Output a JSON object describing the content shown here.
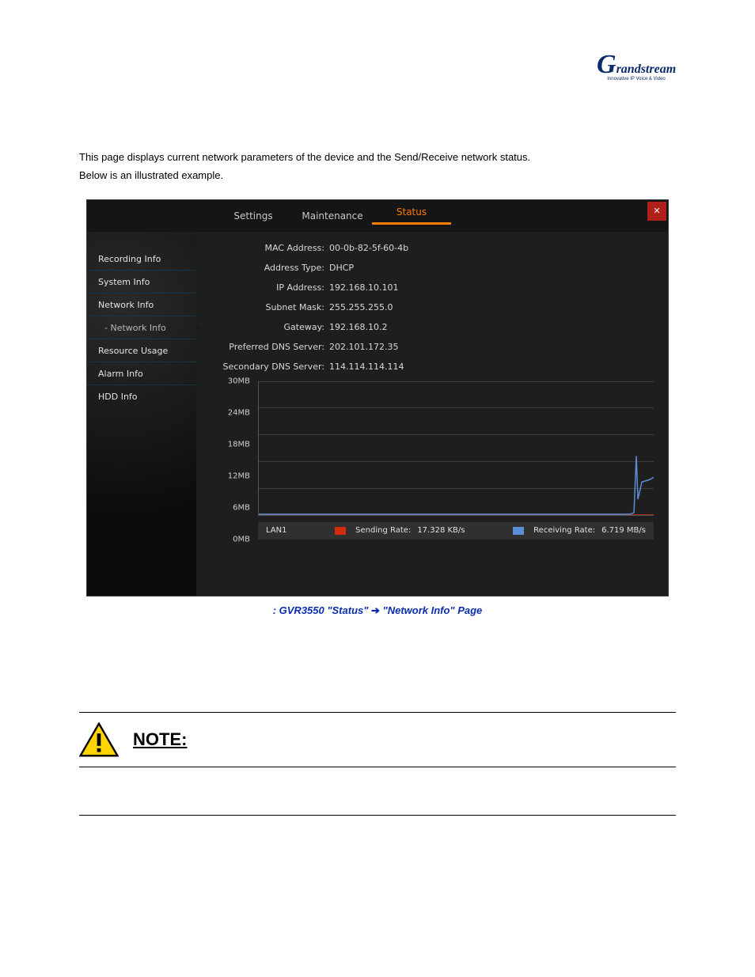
{
  "logo": {
    "brand_top": "G",
    "brand_bot": "randstream",
    "tagline": "Innovative IP Voice & Video"
  },
  "intro": {
    "p1": "This page displays current network parameters of the device and the Send/Receive network status.",
    "p2": "Below is an illustrated example."
  },
  "tabs": {
    "settings": "Settings",
    "maintenance": "Maintenance",
    "status": "Status"
  },
  "sidebar": {
    "items": [
      {
        "label": "Recording Info"
      },
      {
        "label": "System Info"
      },
      {
        "label": "Network Info"
      },
      {
        "label": "- Network Info",
        "sub": true
      },
      {
        "label": "Resource Usage"
      },
      {
        "label": "Alarm Info"
      },
      {
        "label": "HDD Info"
      }
    ]
  },
  "info": {
    "mac_label": "MAC Address:",
    "mac_val": "00-0b-82-5f-60-4b",
    "addr_type_label": "Address Type:",
    "addr_type_val": "DHCP",
    "ip_label": "IP Address:",
    "ip_val": "192.168.10.101",
    "mask_label": "Subnet Mask:",
    "mask_val": "255.255.255.0",
    "gw_label": "Gateway:",
    "gw_val": "192.168.10.2",
    "dns1_label": "Preferred DNS Server:",
    "dns1_val": "202.101.172.35",
    "dns2_label": "Secondary DNS Server:",
    "dns2_val": "114.114.114.114"
  },
  "chart_data": {
    "type": "line",
    "ylabel_unit": "MB",
    "ylim": [
      0,
      30
    ],
    "y_ticks": [
      "30MB",
      "24MB",
      "18MB",
      "12MB",
      "6MB",
      "0MB"
    ],
    "x_samples": 60,
    "series": [
      {
        "name": "Sending Rate",
        "color": "#d42b0f",
        "values_mb": 0.017
      },
      {
        "name": "Receiving Rate",
        "color": "#5a8fd6",
        "values_mb": 6.719,
        "shape": "flat_then_spike_at_end"
      }
    ],
    "legend": {
      "lan": "LAN1",
      "send_label": "Sending Rate:",
      "send_val": "17.328 KB/s",
      "recv_label": "Receiving Rate:",
      "recv_val": "6.719 MB/s"
    }
  },
  "caption": {
    "prefix": ":  GVR3550 \"Status\" ",
    "arrow": "➔",
    "suffix": " \"Network Info\" Page"
  },
  "note": {
    "label": "NOTE:"
  },
  "footer": {
    "left": "",
    "right": ""
  }
}
